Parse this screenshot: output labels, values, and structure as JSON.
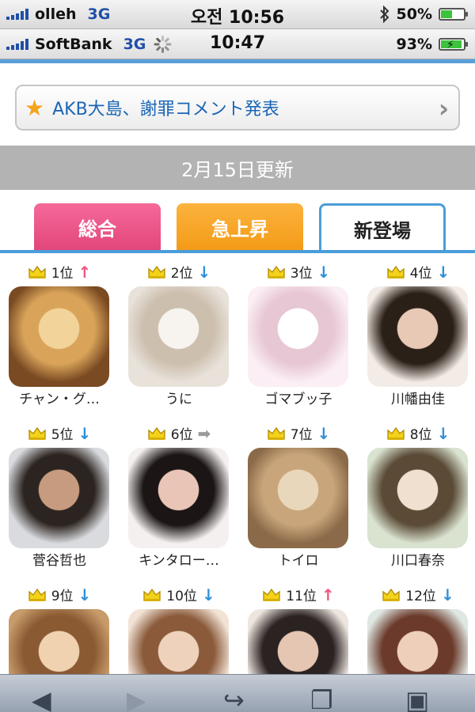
{
  "status_outer": {
    "carrier": "olleh",
    "network": "3G",
    "time": "오전 10:56",
    "battery_text": "50%",
    "battery_level": 0.5
  },
  "status_inner": {
    "carrier": "SoftBank",
    "network": "3G",
    "time": "10:47",
    "battery_text": "93%",
    "battery_level": 0.93
  },
  "banner": {
    "icon": "star-icon",
    "text": "AKB大島、謝罪コメント発表"
  },
  "update": {
    "text": "2月15日更新"
  },
  "tabs": [
    {
      "label": "総合",
      "color": "#e8507f"
    },
    {
      "label": "急上昇",
      "color": "#f5a423"
    },
    {
      "label": "新登場",
      "selected": true
    }
  ],
  "ranking": [
    {
      "rank": "1位",
      "trend": "up",
      "name": "チャン・グ…"
    },
    {
      "rank": "2位",
      "trend": "down",
      "name": "うに"
    },
    {
      "rank": "3位",
      "trend": "down",
      "name": "ゴマブッ子"
    },
    {
      "rank": "4位",
      "trend": "down",
      "name": "川幡由佳"
    },
    {
      "rank": "5位",
      "trend": "down",
      "name": "菅谷哲也"
    },
    {
      "rank": "6位",
      "trend": "right",
      "name": "キンタロー…"
    },
    {
      "rank": "7位",
      "trend": "down",
      "name": "トイロ"
    },
    {
      "rank": "8位",
      "trend": "down",
      "name": "川口春奈"
    },
    {
      "rank": "9位",
      "trend": "down",
      "name": ""
    },
    {
      "rank": "10位",
      "trend": "down",
      "name": ""
    },
    {
      "rank": "11位",
      "trend": "up",
      "name": ""
    },
    {
      "rank": "12位",
      "trend": "down",
      "name": ""
    }
  ],
  "toolbar": {
    "icons": [
      "back-icon",
      "forward-icon",
      "share-icon",
      "bookmarks-icon",
      "tabs-icon"
    ]
  },
  "colors": {
    "accent_blue": "#4a9dd9",
    "link_blue": "#1b66b5",
    "up_pink": "#f0557f",
    "down_blue": "#2f8fd9"
  }
}
